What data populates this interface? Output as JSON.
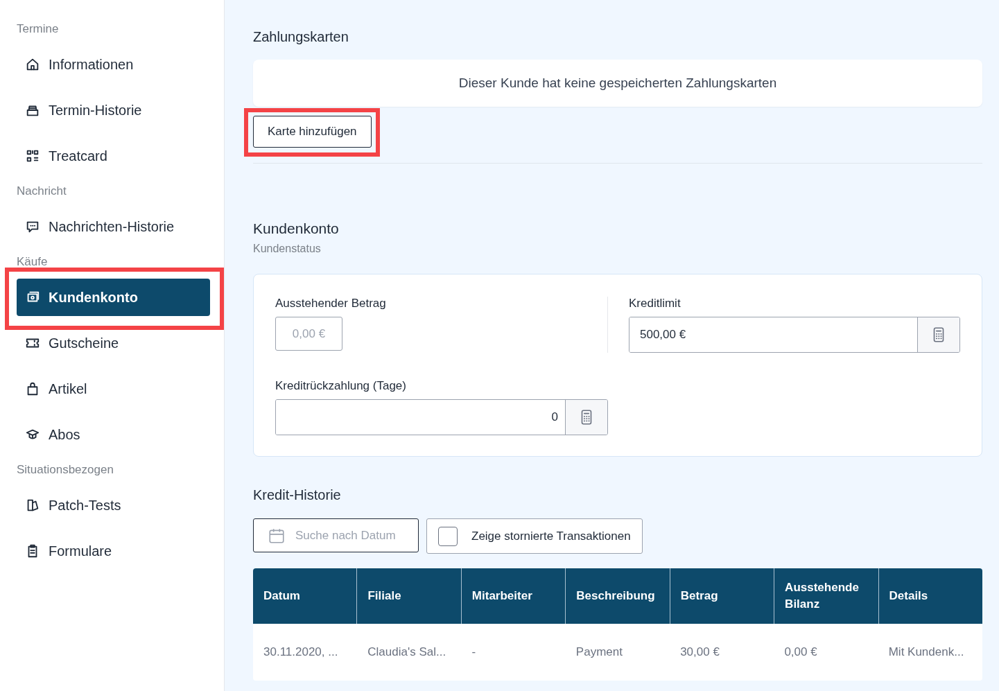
{
  "sidebar": {
    "groups": [
      {
        "heading": "Termine",
        "items": [
          {
            "label": "Informationen",
            "selected": false,
            "highlighted": false
          },
          {
            "label": "Termin-Historie",
            "selected": false,
            "highlighted": false
          },
          {
            "label": "Treatcard",
            "selected": false,
            "highlighted": false
          }
        ]
      },
      {
        "heading": "Nachricht",
        "items": [
          {
            "label": "Nachrichten-Historie",
            "selected": false,
            "highlighted": false
          }
        ]
      },
      {
        "heading": "Käufe",
        "items": [
          {
            "label": "Kundenkonto",
            "selected": true,
            "highlighted": true
          },
          {
            "label": "Gutscheine",
            "selected": false,
            "highlighted": false
          },
          {
            "label": "Artikel",
            "selected": false,
            "highlighted": false
          },
          {
            "label": "Abos",
            "selected": false,
            "highlighted": false
          }
        ]
      },
      {
        "heading": "Situationsbezogen",
        "items": [
          {
            "label": "Patch-Tests",
            "selected": false,
            "highlighted": false
          },
          {
            "label": "Formulare",
            "selected": false,
            "highlighted": false
          }
        ]
      }
    ]
  },
  "payment_cards": {
    "title": "Zahlungskarten",
    "empty_message": "Dieser Kunde hat keine gespeicherten Zahlungskarten",
    "add_button": {
      "label": "Karte hinzufügen",
      "highlighted": true
    }
  },
  "customer_account": {
    "title": "Kundenkonto",
    "subtitle": "Kundenstatus",
    "outstanding": {
      "label": "Ausstehender Betrag",
      "value": "0,00 €",
      "disabled": true
    },
    "credit_limit": {
      "label": "Kreditlimit",
      "value": "500,00 €"
    },
    "repayment_days": {
      "label": "Kreditrückzahlung (Tage)",
      "value": "0"
    }
  },
  "credit_history": {
    "title": "Kredit-Historie",
    "date_search": {
      "placeholder": "Suche nach Datum"
    },
    "show_cancelled": {
      "label": "Zeige stornierte Transaktionen",
      "checked": false
    },
    "table": {
      "columns": [
        "Datum",
        "Filiale",
        "Mitarbeiter",
        "Beschreibung",
        "Betrag",
        "Ausstehende Bilanz",
        "Details"
      ],
      "rows": [
        [
          "30.11.2020, ...",
          "Claudia's Sal...",
          "-",
          "Payment",
          "30,00 €",
          "0,00 €",
          "Mit Kundenk..."
        ]
      ]
    }
  }
}
